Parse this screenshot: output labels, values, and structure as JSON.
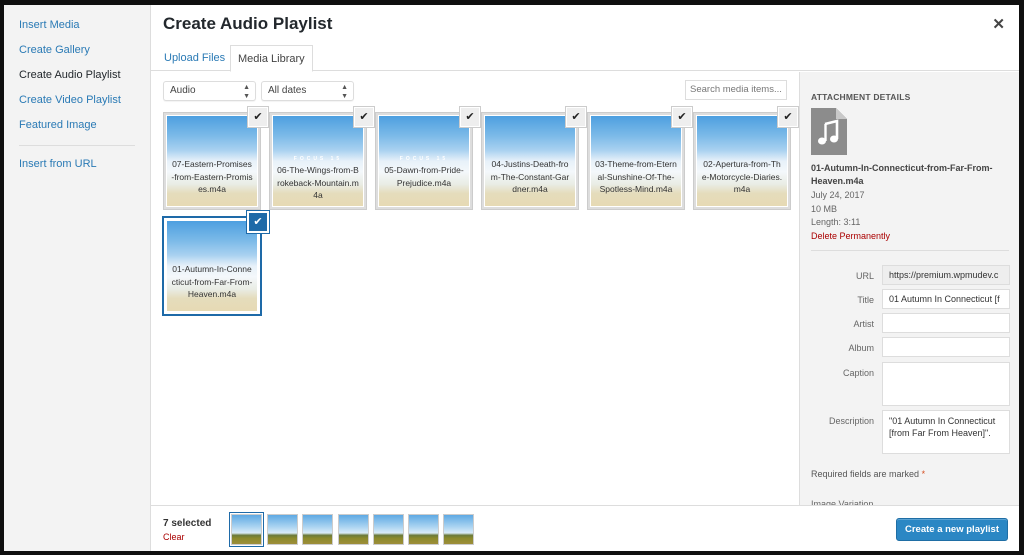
{
  "menu": {
    "items": [
      {
        "label": "Insert Media",
        "active": false
      },
      {
        "label": "Create Gallery",
        "active": false
      },
      {
        "label": "Create Audio Playlist",
        "active": true
      },
      {
        "label": "Create Video Playlist",
        "active": false
      },
      {
        "label": "Featured Image",
        "active": false
      }
    ],
    "insert_from_url": "Insert from URL"
  },
  "header": {
    "title": "Create Audio Playlist",
    "close_icon": "close-icon"
  },
  "tabs": [
    {
      "label": "Upload Files",
      "active": false
    },
    {
      "label": "Media Library",
      "active": true
    }
  ],
  "toolbar": {
    "type_filter": "Audio",
    "date_filter": "All dates",
    "search_placeholder": "Search media items..."
  },
  "attachments": [
    {
      "filename": "07-Eastern-Promises-from-Eastern-Promises.m4a",
      "selected": true,
      "current": false,
      "overlay": ""
    },
    {
      "filename": "06-The-Wings-from-Brokeback-Mountain.m4a",
      "selected": true,
      "current": false,
      "overlay": "FOCUS 15"
    },
    {
      "filename": "05-Dawn-from-Pride-Prejudice.m4a",
      "selected": true,
      "current": false,
      "overlay": "FOCUS 15"
    },
    {
      "filename": "04-Justins-Death-from-The-Constant-Gardner.m4a",
      "selected": true,
      "current": false,
      "overlay": ""
    },
    {
      "filename": "03-Theme-from-Eternal-Sunshine-Of-The-Spotless-Mind.m4a",
      "selected": true,
      "current": false,
      "overlay": ""
    },
    {
      "filename": "02-Apertura-from-The-Motorcycle-Diaries.m4a",
      "selected": true,
      "current": false,
      "overlay": ""
    },
    {
      "filename": "01-Autumn-In-Connecticut-from-Far-From-Heaven.m4a",
      "selected": true,
      "current": true,
      "overlay": ""
    }
  ],
  "details": {
    "heading": "ATTACHMENT DETAILS",
    "file_icon": "audio-file-icon",
    "filename": "01-Autumn-In-Connecticut-from-Far-From-Heaven.m4a",
    "date": "July 24, 2017",
    "size": "10 MB",
    "length": "Length: 3:11",
    "delete_label": "Delete Permanently",
    "fields": {
      "url": {
        "label": "URL",
        "value": "https://premium.wpmudev.c"
      },
      "title": {
        "label": "Title",
        "value": "01 Autumn In Connecticut [f"
      },
      "artist": {
        "label": "Artist",
        "value": ""
      },
      "album": {
        "label": "Album",
        "value": ""
      },
      "caption": {
        "label": "Caption",
        "value": ""
      },
      "description": {
        "label": "Description",
        "value": "\"01 Autumn In Connecticut [from Far From Heaven]\"."
      }
    },
    "required_note": "Required fields are marked",
    "required_star": "*",
    "image_variation": "Image Variation"
  },
  "footer": {
    "selected_count": "7 selected",
    "clear_label": "Clear",
    "mini_count": 7,
    "create_button": "Create a new playlist"
  },
  "colors": {
    "accent": "#2b87c4",
    "link": "#2a7ab5",
    "danger": "#aa0000",
    "selection": "#1e6aa8"
  }
}
